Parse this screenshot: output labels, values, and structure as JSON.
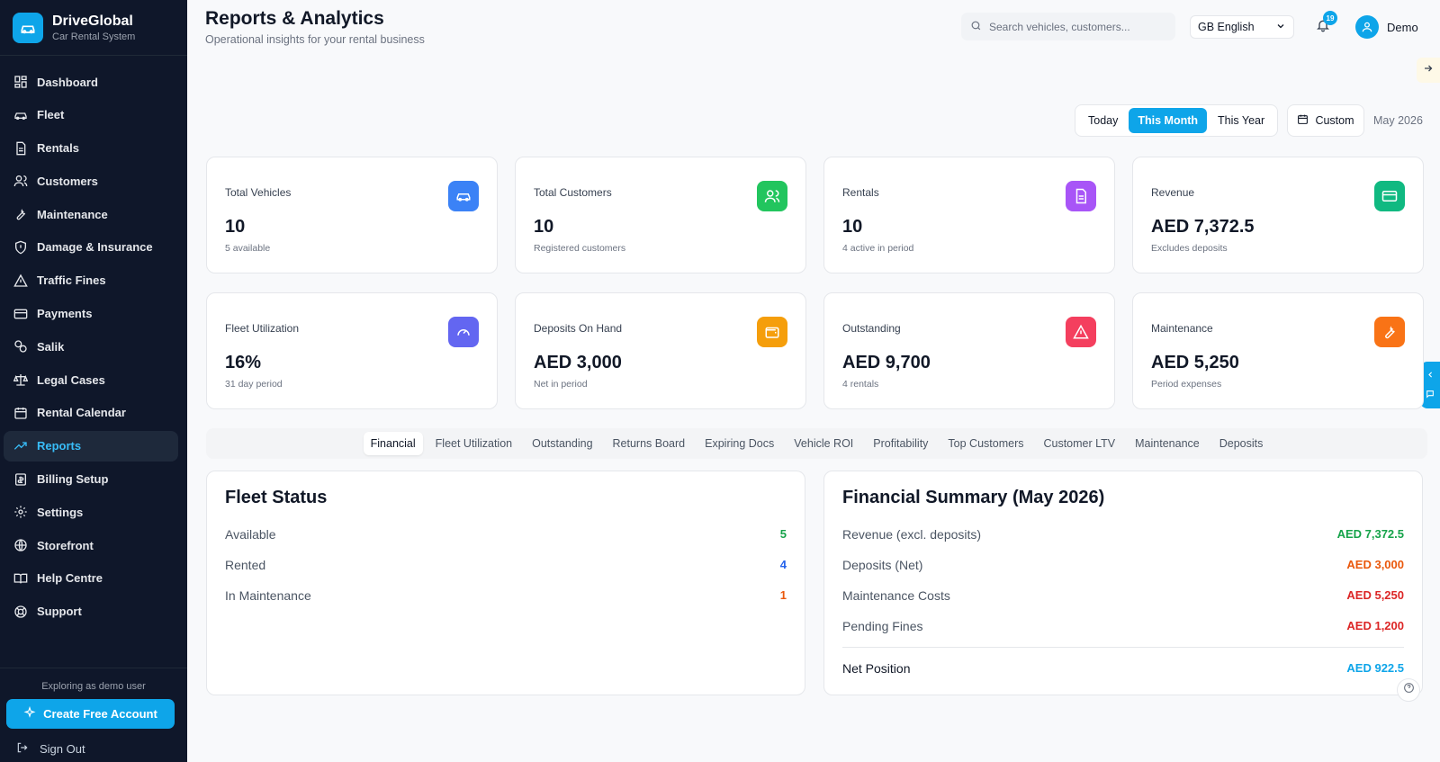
{
  "brand": {
    "name": "DriveGlobal",
    "subtitle": "Car Rental System"
  },
  "nav": [
    {
      "label": "Dashboard",
      "icon": "dashboard-icon"
    },
    {
      "label": "Fleet",
      "icon": "car-icon"
    },
    {
      "label": "Rentals",
      "icon": "document-icon"
    },
    {
      "label": "Customers",
      "icon": "users-icon"
    },
    {
      "label": "Maintenance",
      "icon": "wrench-icon"
    },
    {
      "label": "Damage & Insurance",
      "icon": "shield-icon"
    },
    {
      "label": "Traffic Fines",
      "icon": "warning-icon"
    },
    {
      "label": "Payments",
      "icon": "credit-card-icon"
    },
    {
      "label": "Salik",
      "icon": "toll-icon"
    },
    {
      "label": "Legal Cases",
      "icon": "scale-icon"
    },
    {
      "label": "Rental Calendar",
      "icon": "calendar-icon"
    },
    {
      "label": "Reports",
      "icon": "trending-up-icon",
      "active": true
    },
    {
      "label": "Billing Setup",
      "icon": "billing-icon"
    },
    {
      "label": "Settings",
      "icon": "gear-icon"
    },
    {
      "label": "Storefront",
      "icon": "globe-icon"
    },
    {
      "label": "Help Centre",
      "icon": "book-icon"
    },
    {
      "label": "Support",
      "icon": "lifebuoy-icon"
    }
  ],
  "sidebar_bottom": {
    "demo_note": "Exploring as demo user",
    "create_account": "Create Free Account",
    "sign_out": "Sign Out"
  },
  "header": {
    "title": "Reports & Analytics",
    "subtitle": "Operational insights for your rental business",
    "search_placeholder": "Search vehicles, customers...",
    "language": "GB English",
    "notification_count": "19",
    "user_name": "Demo"
  },
  "period": {
    "options": [
      "Today",
      "This Month",
      "This Year"
    ],
    "active": "This Month",
    "custom_label": "Custom",
    "current_label": "May 2026"
  },
  "stats": [
    {
      "label": "Total Vehicles",
      "value": "10",
      "sub": "5 available",
      "icon": "car-icon",
      "color": "#3b82f6"
    },
    {
      "label": "Total Customers",
      "value": "10",
      "sub": "Registered customers",
      "icon": "users-icon",
      "color": "#22c55e"
    },
    {
      "label": "Rentals",
      "value": "10",
      "sub": "4 active in period",
      "icon": "document-icon",
      "color": "#a855f7"
    },
    {
      "label": "Revenue",
      "value": "AED 7,372.5",
      "sub": "Excludes deposits",
      "icon": "credit-card-icon",
      "color": "#10b981"
    },
    {
      "label": "Fleet Utilization",
      "value": "16%",
      "sub": "31 day period",
      "icon": "gauge-icon",
      "color": "#6366f1"
    },
    {
      "label": "Deposits On Hand",
      "value": "AED 3,000",
      "sub": "Net in period",
      "icon": "wallet-icon",
      "color": "#f59e0b"
    },
    {
      "label": "Outstanding",
      "value": "AED 9,700",
      "sub": "4 rentals",
      "icon": "warning-icon",
      "color": "#f43f5e"
    },
    {
      "label": "Maintenance",
      "value": "AED 5,250",
      "sub": "Period expenses",
      "icon": "wrench-icon",
      "color": "#f97316"
    }
  ],
  "tabs": [
    "Financial",
    "Fleet Utilization",
    "Outstanding",
    "Returns Board",
    "Expiring Docs",
    "Vehicle ROI",
    "Profitability",
    "Top Customers",
    "Customer LTV",
    "Maintenance",
    "Deposits"
  ],
  "active_tab": "Financial",
  "fleet_status": {
    "title": "Fleet Status",
    "rows": [
      {
        "label": "Available",
        "value": "5",
        "color": "#16a34a"
      },
      {
        "label": "Rented",
        "value": "4",
        "color": "#2563eb"
      },
      {
        "label": "In Maintenance",
        "value": "1",
        "color": "#ea580c"
      }
    ]
  },
  "financial_summary": {
    "title": "Financial Summary (May 2026)",
    "rows": [
      {
        "label": "Revenue (excl. deposits)",
        "value": "AED 7,372.5",
        "color": "#16a34a"
      },
      {
        "label": "Deposits (Net)",
        "value": "AED 3,000",
        "color": "#ea580c"
      },
      {
        "label": "Maintenance Costs",
        "value": "AED 5,250",
        "color": "#dc2626"
      },
      {
        "label": "Pending Fines",
        "value": "AED 1,200",
        "color": "#dc2626"
      }
    ],
    "net_label": "Net Position",
    "net_value": "AED 922.5",
    "net_color": "#0ea5e9"
  }
}
